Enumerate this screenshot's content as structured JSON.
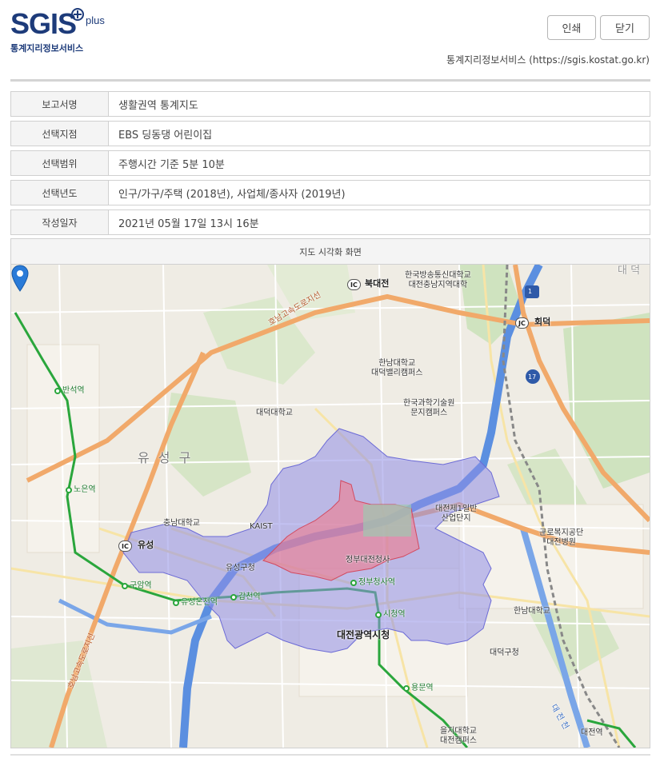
{
  "header": {
    "logo_text": "SGIS",
    "logo_plus": "plus",
    "logo_subtitle": "통계지리정보서비스",
    "print_label": "인쇄",
    "close_label": "닫기",
    "site_credit": "통계지리정보서비스 (https://sgis.kostat.go.kr)"
  },
  "report": {
    "rows": [
      {
        "label": "보고서명",
        "value": "생활권역 통계지도"
      },
      {
        "label": "선택지점",
        "value": "EBS 딩동댕 어린이집"
      },
      {
        "label": "선택범위",
        "value": "주행시간 기준 5분 10분"
      },
      {
        "label": "선택년도",
        "value": "인구/가구/주택 (2018년), 사업체/종사자 (2019년)"
      },
      {
        "label": "작성일자",
        "value": "2021년 05월 17일 13시 16분"
      }
    ]
  },
  "map": {
    "title": "지도 시각화 화면",
    "colors": {
      "range_10min": "#8f8ee6",
      "range_5min": "#f07b8c",
      "river": "#5b8fe0",
      "subway": "#2aa63c",
      "highway": "#f1a96a"
    },
    "labels": {
      "district": "유 성 구",
      "city_hall": "대전광역시청",
      "ic_bukdaejeon": "북대전",
      "ic_hoedeok": "회덕",
      "ic_yuseong": "유성",
      "ic_badge": "IC",
      "jc_badge": "JC",
      "highway_name_1": "호남고속도로지선",
      "highway_name_2": "호남고속도로지선",
      "univ_broadcast": "한국방송통신대학교\n대전충남지역대학",
      "univ_hannam_valley": "한남대학교\n대덕밸리캠퍼스",
      "univ_tech": "한국과학기술원\n문지캠퍼스",
      "univ_daeduk": "대덕대학교",
      "univ_chungnam": "충남대학교",
      "kaist": "KAIST",
      "industrial": "대전제1일반\n산업단지",
      "hospital": "근로복지공단\n대전병원",
      "univ_hannam": "한남대학교",
      "daedeok_office": "대덕구청",
      "yuseong_office": "유성구청",
      "govt_complex": "정부대전청사",
      "univ_eulji": "을지대학교\n대전캠퍼스",
      "daejeon_station": "대전역",
      "road_no_1": "1",
      "road_no_17": "17",
      "corner_text": "대 덕",
      "stream_name": "대 전 천"
    },
    "stations": [
      {
        "name": "반석역"
      },
      {
        "name": "노은역"
      },
      {
        "name": "구암역"
      },
      {
        "name": "유성온천역"
      },
      {
        "name": "갑천역"
      },
      {
        "name": "정부청사역"
      },
      {
        "name": "시청역"
      },
      {
        "name": "용문역"
      }
    ]
  }
}
